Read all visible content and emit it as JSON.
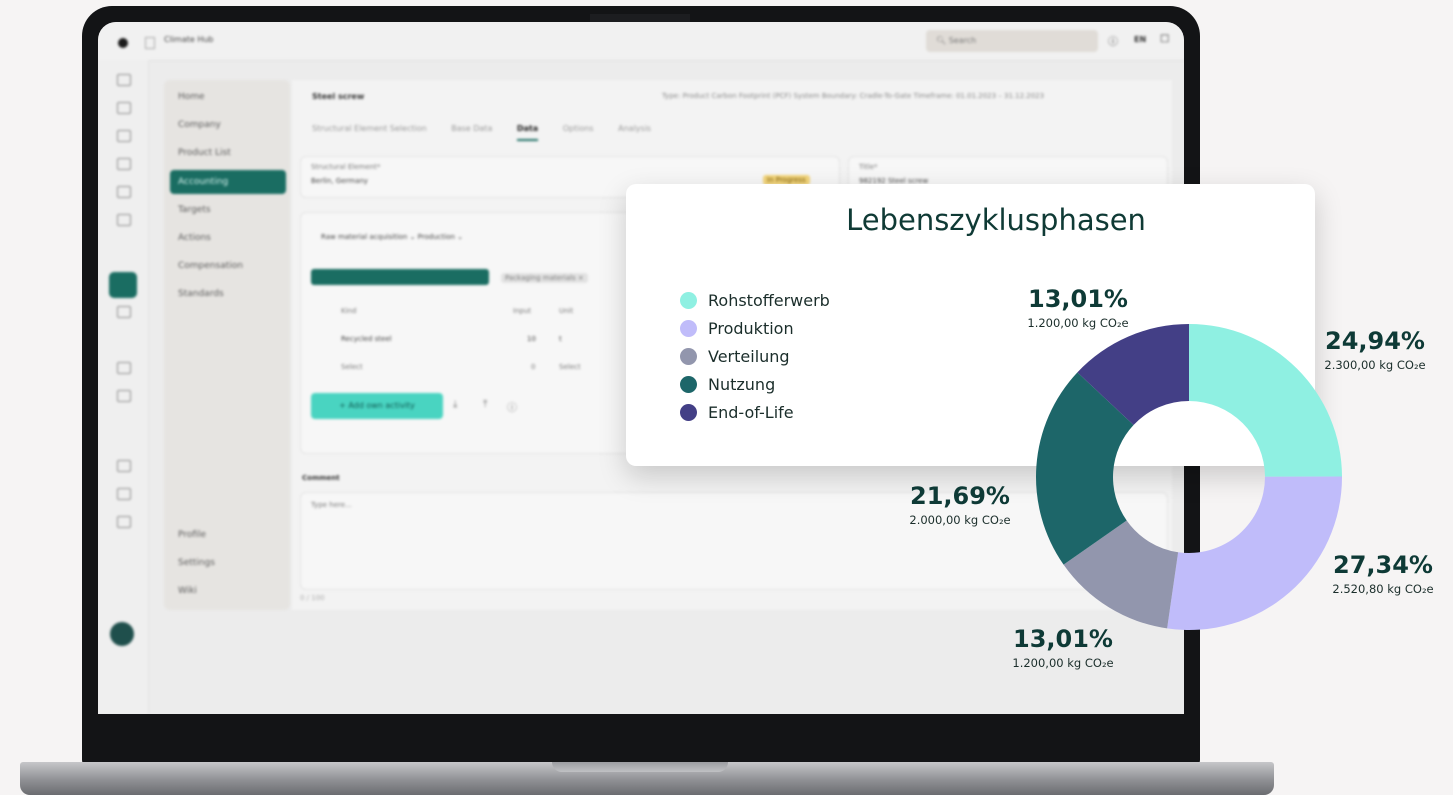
{
  "app": {
    "name": "Climate Hub",
    "search_placeholder": "Search",
    "language": "EN"
  },
  "sidebar": {
    "items": [
      {
        "label": "Home"
      },
      {
        "label": "Company"
      },
      {
        "label": "Product List"
      },
      {
        "label": "Accounting"
      },
      {
        "label": "Targets"
      },
      {
        "label": "Actions"
      },
      {
        "label": "Compensation"
      },
      {
        "label": "Standards"
      }
    ],
    "bottom_items": [
      {
        "label": "Profile"
      },
      {
        "label": "Settings"
      },
      {
        "label": "Wiki"
      }
    ]
  },
  "main": {
    "breadcrumb": "Steel screw",
    "meta": "Type: Product Carbon Footprint (PCF)   System Boundary: Cradle-To-Gate   Timeframe: 01.01.2023 – 31.12.2023",
    "tabs": [
      {
        "label": "Structural Element Selection"
      },
      {
        "label": "Base Data"
      },
      {
        "label": "Data"
      },
      {
        "label": "Options"
      },
      {
        "label": "Analysis"
      }
    ],
    "structural_element_label": "Structural Element*",
    "structural_element_value": "Berlin, Germany",
    "status_badge": "In Progress",
    "title_label": "Title*",
    "title_value": "982192 Steel screw",
    "phase_tabs": "Raw material acquisition ⌄    Production ⌄",
    "chip": "Packaging materials ×",
    "table_headers": [
      "Kind",
      "Input",
      "Unit"
    ],
    "table_rows": [
      [
        "Recycled steel",
        "10",
        "t"
      ],
      [
        "Select",
        "0",
        "Select"
      ]
    ],
    "add_button": "+ Add own activity",
    "comment_label": "Comment",
    "comment_placeholder": "Type here...",
    "char_count": "0 / 100"
  },
  "chart_data": {
    "type": "pie",
    "donut": true,
    "title": "Lebenszyklusphasen",
    "legend_position": "left",
    "series": [
      {
        "name": "Rohstofferwerb",
        "percent": 24.94,
        "percent_label": "24,94%",
        "value": 2300.0,
        "value_label": "2.300,00 kg CO₂e",
        "color": "#8ff0e2"
      },
      {
        "name": "Produktion",
        "percent": 27.34,
        "percent_label": "27,34%",
        "value": 2520.8,
        "value_label": "2.520,80 kg CO₂e",
        "color": "#c0bcfa"
      },
      {
        "name": "Verteilung",
        "percent": 13.01,
        "percent_label": "13,01%",
        "value": 1200.0,
        "value_label": "1.200,00 kg CO₂e",
        "color": "#9296ad"
      },
      {
        "name": "Nutzung",
        "percent": 21.69,
        "percent_label": "21,69%",
        "value": 2000.0,
        "value_label": "2.000,00 kg CO₂e",
        "color": "#1d6669"
      },
      {
        "name": "End-of-Life",
        "percent": 13.01,
        "percent_label": "13,01%",
        "value": 1200.0,
        "value_label": "1.200,00 kg CO₂e",
        "color": "#433f86"
      }
    ]
  }
}
